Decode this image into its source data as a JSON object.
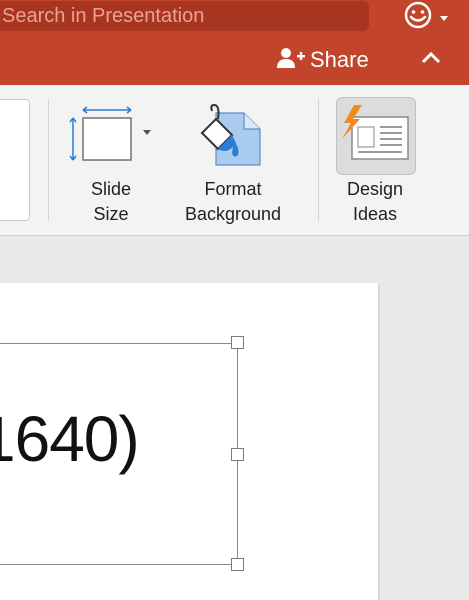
{
  "search": {
    "placeholder": "Search in Presentation"
  },
  "share": {
    "label": "Share"
  },
  "ribbon": {
    "slide_size": {
      "line1": "Slide",
      "line2": "Size"
    },
    "format_background": {
      "line1": "Format",
      "line2": "Background"
    },
    "design_ideas": {
      "line1": "Design",
      "line2": "Ideas"
    }
  },
  "slide": {
    "text": "1640)"
  },
  "colors": {
    "titlebar": "#c2452b",
    "search_bg": "#a8351f",
    "ribbon": "#f3f3f3"
  }
}
